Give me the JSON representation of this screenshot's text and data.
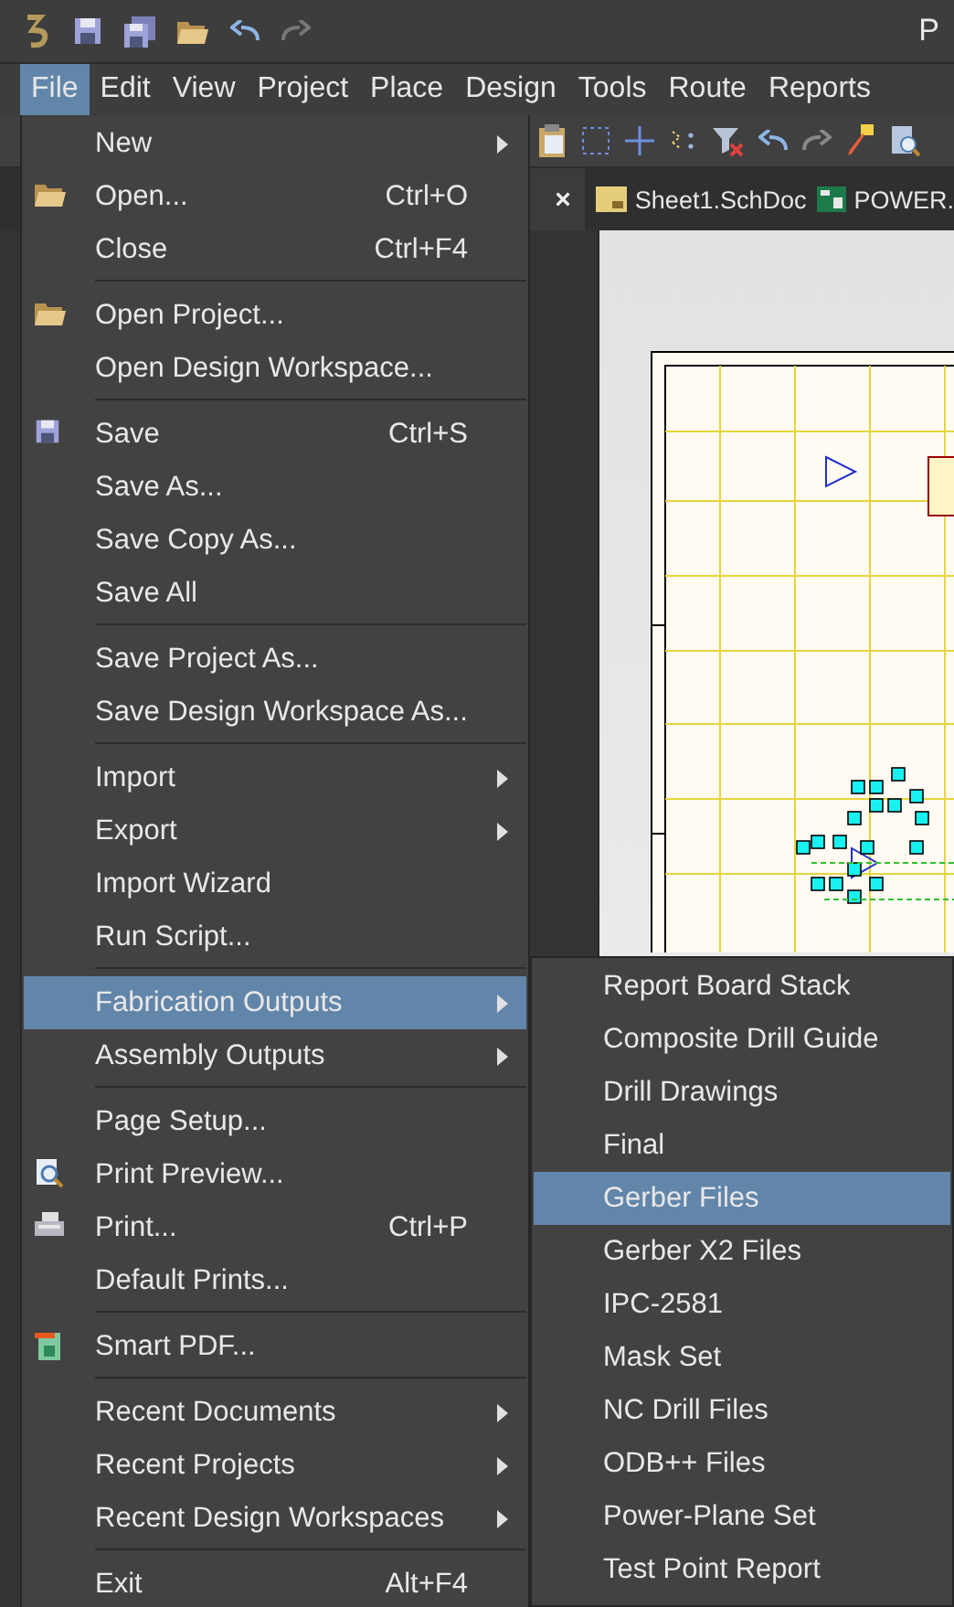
{
  "title_bar": {
    "title": "P"
  },
  "menu_bar": [
    {
      "label": "File",
      "selected": true
    },
    {
      "label": "Edit",
      "selected": false
    },
    {
      "label": "View",
      "selected": false
    },
    {
      "label": "Project",
      "selected": false
    },
    {
      "label": "Place",
      "selected": false
    },
    {
      "label": "Design",
      "selected": false
    },
    {
      "label": "Tools",
      "selected": false
    },
    {
      "label": "Route",
      "selected": false
    },
    {
      "label": "Reports",
      "selected": false
    }
  ],
  "document_tabs": [
    {
      "kind": "partial",
      "close": "×",
      "selected": true
    },
    {
      "kind": "sheet",
      "label": "Sheet1.SchDoc",
      "selected": false
    },
    {
      "kind": "board",
      "label": "POWER.",
      "selected": false
    }
  ],
  "file_menu": [
    {
      "kind": "item",
      "label": "New",
      "submenu": true,
      "selected": false
    },
    {
      "kind": "folder",
      "label": "Open...",
      "shortcut": "Ctrl+O",
      "submenu": false,
      "selected": false
    },
    {
      "kind": "item",
      "label": "Close",
      "shortcut": "Ctrl+F4",
      "submenu": false,
      "selected": false
    },
    {
      "kind": "separator"
    },
    {
      "kind": "folder",
      "label": "Open Project...",
      "submenu": false,
      "selected": false
    },
    {
      "kind": "item",
      "label": "Open Design Workspace...",
      "submenu": false,
      "selected": false
    },
    {
      "kind": "separator"
    },
    {
      "kind": "save",
      "label": "Save",
      "shortcut": "Ctrl+S",
      "submenu": false,
      "selected": false
    },
    {
      "kind": "item",
      "label": "Save As...",
      "submenu": false,
      "selected": false
    },
    {
      "kind": "item",
      "label": "Save Copy As...",
      "submenu": false,
      "selected": false
    },
    {
      "kind": "item",
      "label": "Save All",
      "submenu": false,
      "selected": false
    },
    {
      "kind": "separator"
    },
    {
      "kind": "item",
      "label": "Save Project As...",
      "submenu": false,
      "selected": false
    },
    {
      "kind": "item",
      "label": "Save Design Workspace As...",
      "submenu": false,
      "selected": false
    },
    {
      "kind": "separator"
    },
    {
      "kind": "item",
      "label": "Import",
      "submenu": true,
      "selected": false
    },
    {
      "kind": "item",
      "label": "Export",
      "submenu": true,
      "selected": false
    },
    {
      "kind": "item",
      "label": "Import Wizard",
      "submenu": false,
      "selected": false
    },
    {
      "kind": "item",
      "label": "Run Script...",
      "submenu": false,
      "selected": false
    },
    {
      "kind": "separator"
    },
    {
      "kind": "item",
      "label": "Fabrication Outputs",
      "submenu": true,
      "selected": true
    },
    {
      "kind": "item",
      "label": "Assembly Outputs",
      "submenu": true,
      "selected": false
    },
    {
      "kind": "separator"
    },
    {
      "kind": "item",
      "label": "Page Setup...",
      "submenu": false,
      "selected": false
    },
    {
      "kind": "preview",
      "label": "Print Preview...",
      "submenu": false,
      "selected": false
    },
    {
      "kind": "printer",
      "label": "Print...",
      "shortcut": "Ctrl+P",
      "submenu": false,
      "selected": false
    },
    {
      "kind": "item",
      "label": "Default Prints...",
      "submenu": false,
      "selected": false
    },
    {
      "kind": "separator"
    },
    {
      "kind": "pdf",
      "label": "Smart PDF...",
      "submenu": false,
      "selected": false
    },
    {
      "kind": "separator"
    },
    {
      "kind": "item",
      "label": "Recent Documents",
      "submenu": true,
      "selected": false
    },
    {
      "kind": "item",
      "label": "Recent Projects",
      "submenu": true,
      "selected": false
    },
    {
      "kind": "item",
      "label": "Recent Design Workspaces",
      "submenu": true,
      "selected": false
    },
    {
      "kind": "separator"
    },
    {
      "kind": "item",
      "label": "Exit",
      "shortcut": "Alt+F4",
      "submenu": false,
      "selected": false
    }
  ],
  "fabrication_submenu": [
    {
      "label": "Report Board Stack",
      "selected": false
    },
    {
      "label": "Composite Drill Guide",
      "selected": false
    },
    {
      "label": "Drill Drawings",
      "selected": false
    },
    {
      "label": "Final",
      "selected": false
    },
    {
      "label": "Gerber Files",
      "selected": true
    },
    {
      "label": "Gerber X2 Files",
      "selected": false
    },
    {
      "label": "IPC-2581",
      "selected": false
    },
    {
      "label": "Mask Set",
      "selected": false
    },
    {
      "label": "NC Drill Files",
      "selected": false
    },
    {
      "label": "ODB++ Files",
      "selected": false
    },
    {
      "label": "Power-Plane Set",
      "selected": false
    },
    {
      "label": "Test Point Report",
      "selected": false
    }
  ]
}
